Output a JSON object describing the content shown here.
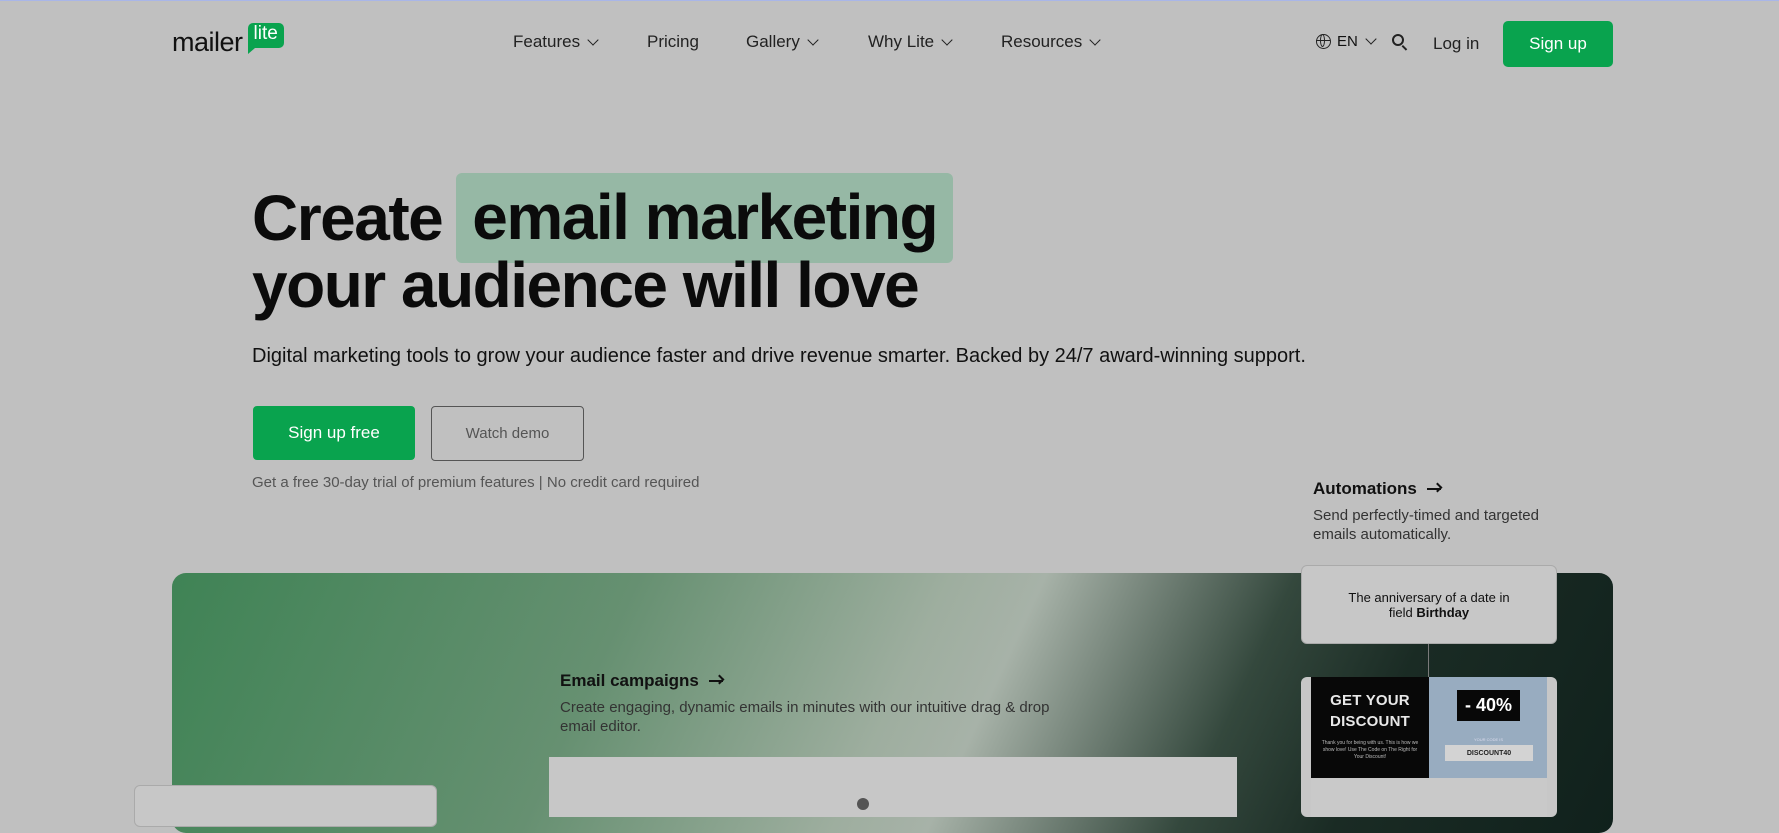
{
  "nav": {
    "logo_word": "mailer",
    "logo_badge": "lite",
    "items": [
      {
        "label": "Features",
        "dropdown": true
      },
      {
        "label": "Pricing",
        "dropdown": false
      },
      {
        "label": "Gallery",
        "dropdown": true
      },
      {
        "label": "Why Lite",
        "dropdown": true
      },
      {
        "label": "Resources",
        "dropdown": true
      }
    ],
    "language": "EN",
    "login": "Log in",
    "signup": "Sign up"
  },
  "hero": {
    "title_pre": "Create",
    "title_highlight": "email marketing",
    "title_line2": "your audience will love",
    "subtitle": "Digital marketing tools to grow your audience faster and drive revenue smarter. Backed by 24/7 award-winning support.",
    "cta_primary": "Sign up free",
    "cta_secondary": "Watch demo",
    "note": "Get a free 30-day trial of premium features | No credit card required"
  },
  "features": {
    "automations": {
      "title": "Automations",
      "desc": "Send perfectly-timed and targeted emails automatically.",
      "trigger_line1": "The anniversary of a date in",
      "trigger_prefix": "field ",
      "trigger_field": "Birthday"
    },
    "campaigns": {
      "title": "Email campaigns",
      "desc": "Create engaging, dynamic emails in minutes with our intuitive drag & drop email editor."
    },
    "email_preview": {
      "headline": "GET YOUR DISCOUNT",
      "body": "Thank you for being with us. This is how we show love! Use The Code on The Right for Your Discount!",
      "percent": "- 40%",
      "code_label": "YOUR CODE IS",
      "code": "DISCOUNT40"
    }
  },
  "colors": {
    "brand_green": "#09a34e",
    "highlight": "#96b8a5",
    "background": "#c0c0c0"
  }
}
